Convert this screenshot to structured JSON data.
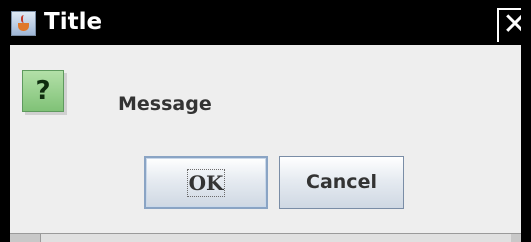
{
  "window": {
    "title": "Title",
    "close_glyph": "✕",
    "app_icon": "java-cup-icon"
  },
  "dialog": {
    "icon": "question-icon",
    "icon_glyph": "?",
    "message": "Message"
  },
  "buttons": {
    "ok_label": "OK",
    "cancel_label": "Cancel"
  },
  "colors": {
    "titlebar": "#000000",
    "question_icon": "#8fcf85",
    "button_border": "#7a8da6"
  }
}
